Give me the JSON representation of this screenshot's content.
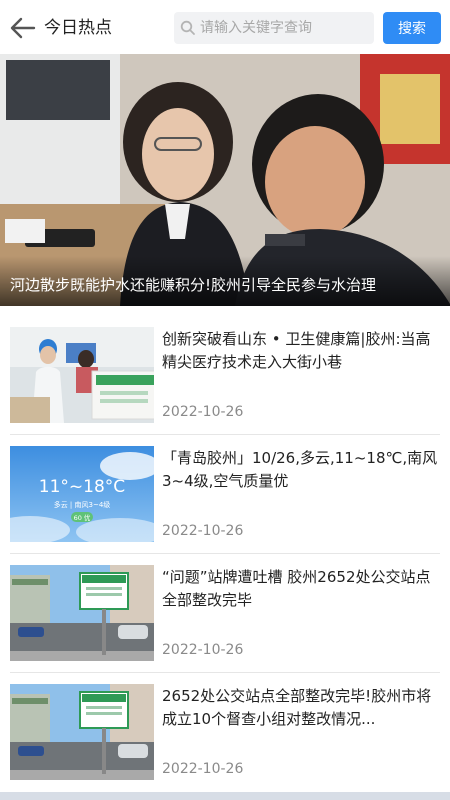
{
  "header": {
    "title": "今日热点",
    "search_placeholder": "请输入关键字查询",
    "search_label": "搜索",
    "accent": "#2f8cf5"
  },
  "hero": {
    "caption": "河边散步既能护水还能赚积分!胶州引导全民参与水治理"
  },
  "news": [
    {
      "title": "创新突破看山东 • 卫生健康篇|胶州:当高精尖医疗技术走入大街小巷",
      "date": "2022-10-26",
      "thumb": "clinic-photo"
    },
    {
      "title": "「青岛胶州」10/26,多云,11~18℃,南风3~4级,空气质量优",
      "date": "2022-10-26",
      "thumb": "weather-card",
      "weather": {
        "temp": "11°~18°C",
        "detail": "多云 | 南风3~4级",
        "aqi": "60 优"
      }
    },
    {
      "title": "“问题”站牌遭吐槽 胶州2652处公交站点全部整改完毕",
      "date": "2022-10-26",
      "thumb": "bus-stop-photo"
    },
    {
      "title": "2652处公交站点全部整改完毕!胶州市将成立10个督查小组对整改情况...",
      "date": "2022-10-26",
      "thumb": "bus-stop-photo"
    }
  ]
}
